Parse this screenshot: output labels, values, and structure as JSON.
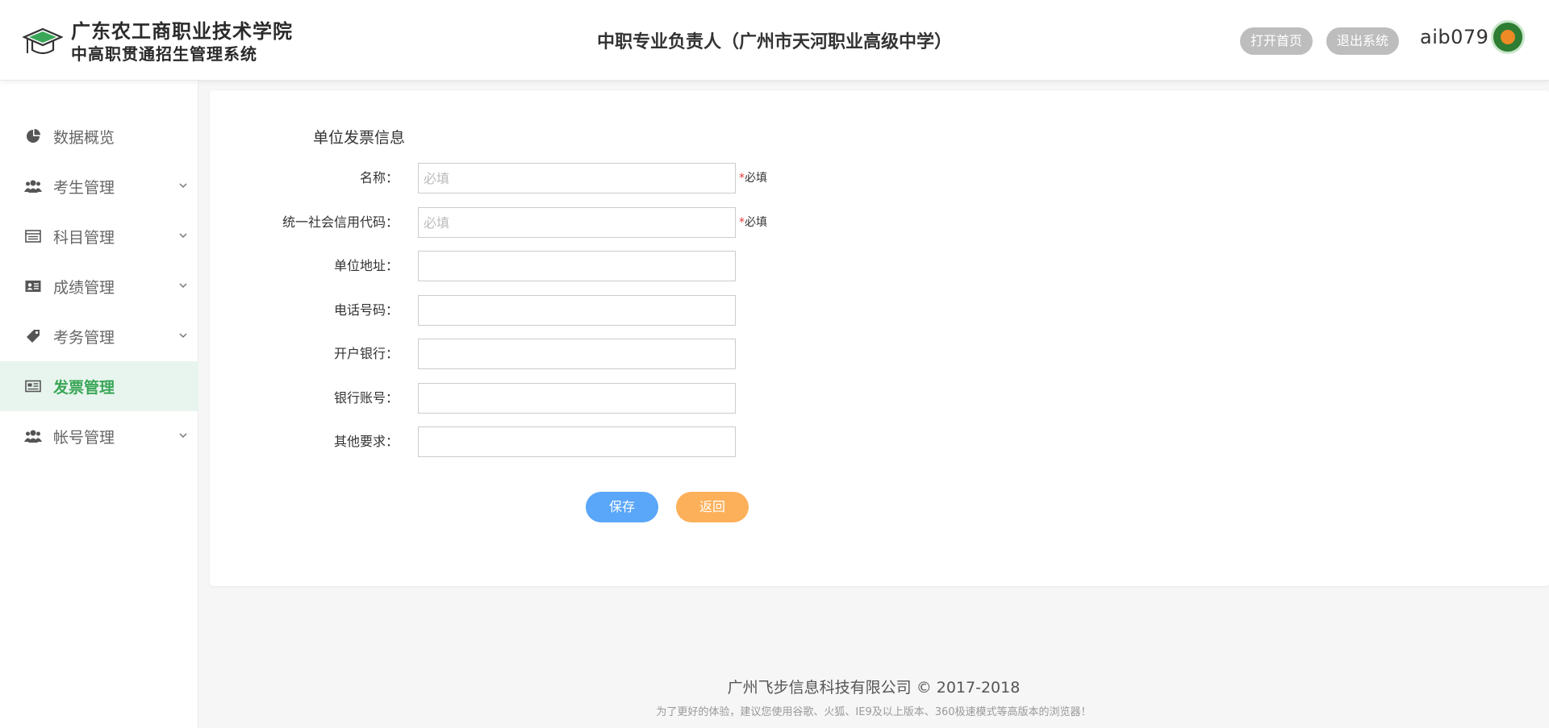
{
  "header": {
    "school_name": "广东农工商职业技术学院",
    "system_name": "中高职贯通招生管理系统",
    "role_title": "中职专业负责人（广州市天河职业高级中学）",
    "home_label": "打开首页",
    "logout_label": "退出系统",
    "username": "aib079"
  },
  "sidebar": {
    "items": [
      {
        "label": "数据概览",
        "icon": "pie-chart-icon",
        "expandable": false,
        "active": false
      },
      {
        "label": "考生管理",
        "icon": "users-icon",
        "expandable": true,
        "active": false
      },
      {
        "label": "科目管理",
        "icon": "list-icon",
        "expandable": true,
        "active": false
      },
      {
        "label": "成绩管理",
        "icon": "id-card-icon",
        "expandable": true,
        "active": false
      },
      {
        "label": "考务管理",
        "icon": "tag-icon",
        "expandable": true,
        "active": false
      },
      {
        "label": "发票管理",
        "icon": "invoice-icon",
        "expandable": false,
        "active": true
      },
      {
        "label": "帐号管理",
        "icon": "users-icon",
        "expandable": true,
        "active": false
      }
    ]
  },
  "form": {
    "title": "单位发票信息",
    "required_note": "必填",
    "fields": [
      {
        "label": "名称：",
        "value": "",
        "placeholder": "必填",
        "required": true
      },
      {
        "label": "统一社会信用代码：",
        "value": "",
        "placeholder": "必填",
        "required": true
      },
      {
        "label": "单位地址：",
        "value": "",
        "placeholder": "",
        "required": false
      },
      {
        "label": "电话号码：",
        "value": "",
        "placeholder": "",
        "required": false
      },
      {
        "label": "开户银行：",
        "value": "",
        "placeholder": "",
        "required": false
      },
      {
        "label": "银行账号：",
        "value": "",
        "placeholder": "",
        "required": false
      },
      {
        "label": "其他要求：",
        "value": "",
        "placeholder": "",
        "required": false
      }
    ],
    "save_label": "保存",
    "back_label": "返回"
  },
  "footer": {
    "company": "广州飞步信息科技有限公司 © 2017-2018",
    "browser_tip": "为了更好的体验，建议您使用谷歌、火狐、IE9及以上版本、360极速模式等高版本的浏览器！"
  },
  "colors": {
    "accent_green": "#3aa657",
    "save_blue": "#5aa6f8",
    "back_orange": "#fdb05a",
    "pill_grey": "#bdbdbd"
  }
}
